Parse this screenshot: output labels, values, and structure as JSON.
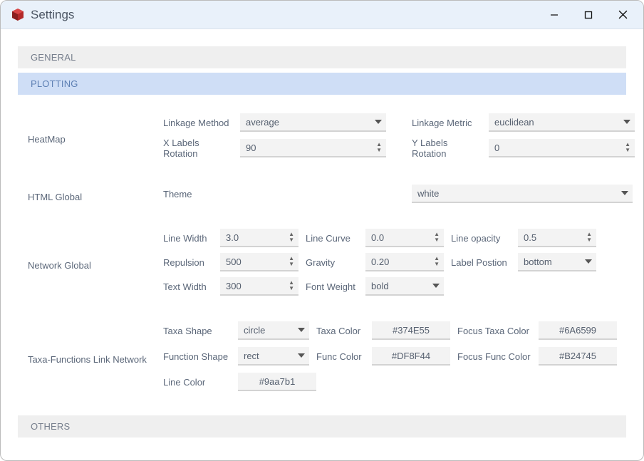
{
  "window": {
    "title": "Settings"
  },
  "sections": {
    "general": "GENERAL",
    "plotting": "PLOTTING",
    "others": "OTHERS"
  },
  "heatmap": {
    "group": "HeatMap",
    "linkage_method_label": "Linkage Method",
    "linkage_method": "average",
    "linkage_metric_label": "Linkage Metric",
    "linkage_metric": "euclidean",
    "x_rotation_label": "X Labels Rotation",
    "x_rotation": "90",
    "y_rotation_label": "Y Labels Rotation",
    "y_rotation": "0"
  },
  "html_global": {
    "group": "HTML Global",
    "theme_label": "Theme",
    "theme": "white"
  },
  "network": {
    "group": "Network Global",
    "line_width_label": "Line Width",
    "line_width": "3.0",
    "line_curve_label": "Line Curve",
    "line_curve": "0.0",
    "line_opacity_label": "Line opacity",
    "line_opacity": "0.5",
    "repulsion_label": "Repulsion",
    "repulsion": "500",
    "gravity_label": "Gravity",
    "gravity": "0.20",
    "label_position_label": "Label Postion",
    "label_position": "bottom",
    "text_width_label": "Text Width",
    "text_width": "300",
    "font_weight_label": "Font Weight",
    "font_weight": "bold"
  },
  "link": {
    "group": "Taxa-Functions Link Network",
    "taxa_shape_label": "Taxa Shape",
    "taxa_shape": "circle",
    "taxa_color_label": "Taxa Color",
    "taxa_color": "#374E55",
    "focus_taxa_color_label": "Focus Taxa Color",
    "focus_taxa_color": "#6A6599",
    "function_shape_label": "Function Shape",
    "function_shape": "rect",
    "func_color_label": "Func Color",
    "func_color": "#DF8F44",
    "focus_func_color_label": "Focus Func Color",
    "focus_func_color": "#B24745",
    "line_color_label": "Line Color",
    "line_color": "#9aa7b1"
  }
}
